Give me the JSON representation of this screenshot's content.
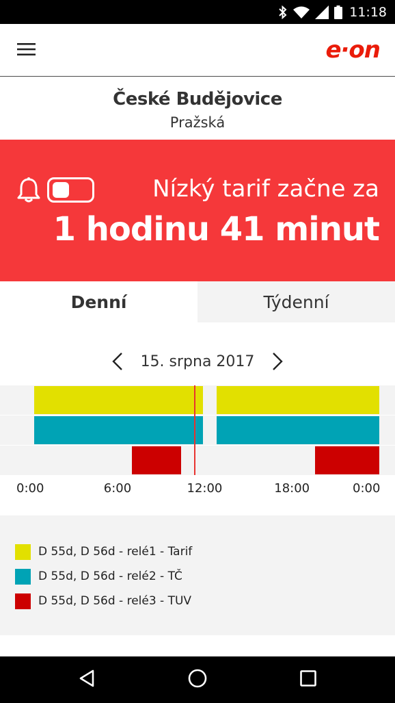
{
  "status_bar": {
    "time": "11:18",
    "icons": [
      "bluetooth-icon",
      "wifi-icon",
      "signal-icon",
      "battery-icon"
    ]
  },
  "app_bar": {
    "menu_icon": "hamburger-menu-icon",
    "logo_text": "e·on",
    "brand_color": "#ea1c0a"
  },
  "location": {
    "city": "České Budějovice",
    "street": "Pražská"
  },
  "banner": {
    "background_color": "#f5383a",
    "bell_icon": "bell-icon",
    "notifications_enabled": false,
    "line1": "Nízký tarif začne za",
    "line2": "1 hodinu 41 minut"
  },
  "tabs": [
    {
      "label": "Denní",
      "selected": true
    },
    {
      "label": "Týdenní",
      "selected": false
    }
  ],
  "date_nav": {
    "prev_icon": "chevron-left-icon",
    "next_icon": "chevron-right-icon",
    "date": "15. srpna 2017"
  },
  "timeline": {
    "day_hours": 24,
    "current_time_hours": 11.3,
    "current_time_color": "#e8332f",
    "rows": [
      {
        "color": "#e2e000",
        "intervals": [
          [
            0.3,
            11.9
          ],
          [
            12.8,
            24.0
          ]
        ]
      },
      {
        "color": "#00a3b5",
        "intervals": [
          [
            0.3,
            11.9
          ],
          [
            12.8,
            24.0
          ]
        ]
      },
      {
        "color": "#cc0000",
        "intervals": [
          [
            7.0,
            10.4
          ],
          [
            19.6,
            24.0
          ]
        ]
      }
    ],
    "ticks": [
      {
        "label": "0:00",
        "hour": 0
      },
      {
        "label": "6:00",
        "hour": 6
      },
      {
        "label": "12:00",
        "hour": 12
      },
      {
        "label": "18:00",
        "hour": 18
      },
      {
        "label": "0:00",
        "hour": 24
      }
    ]
  },
  "legend": [
    {
      "label": "D 55d, D 56d - relé1 - Tarif",
      "color": "#e2e000"
    },
    {
      "label": "D 55d, D 56d - relé2 - TČ",
      "color": "#00a3b5"
    },
    {
      "label": "D 55d, D 56d - relé3 - TUV",
      "color": "#cc0000"
    }
  ],
  "nav_bar": {
    "icons": [
      "back-icon",
      "home-icon",
      "recents-icon"
    ]
  }
}
